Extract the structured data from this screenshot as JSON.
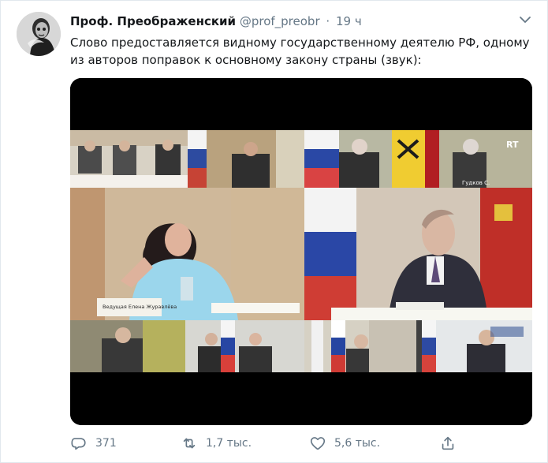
{
  "author": {
    "display_name": "Проф. Преображенский",
    "handle": "@prof_preobr",
    "separator": "·",
    "time": "19 ч"
  },
  "tweet": {
    "text": "Слово предоставляется видному государственному деятелю РФ, одному из авторов поправок к основному закону страны (звук):"
  },
  "media": {
    "type": "video",
    "overlay_logo": "RT",
    "nameplate_text": "Ведущая Елена Журавлёва",
    "nameplate_text_2": "Гудков С."
  },
  "actions": {
    "reply_count": "371",
    "retweet_count": "1,7 тыс.",
    "like_count": "5,6 тыс."
  },
  "icons": {
    "menu": "chevron-down-icon",
    "reply": "reply-icon",
    "retweet": "retweet-icon",
    "like": "heart-icon",
    "share": "share-icon"
  }
}
